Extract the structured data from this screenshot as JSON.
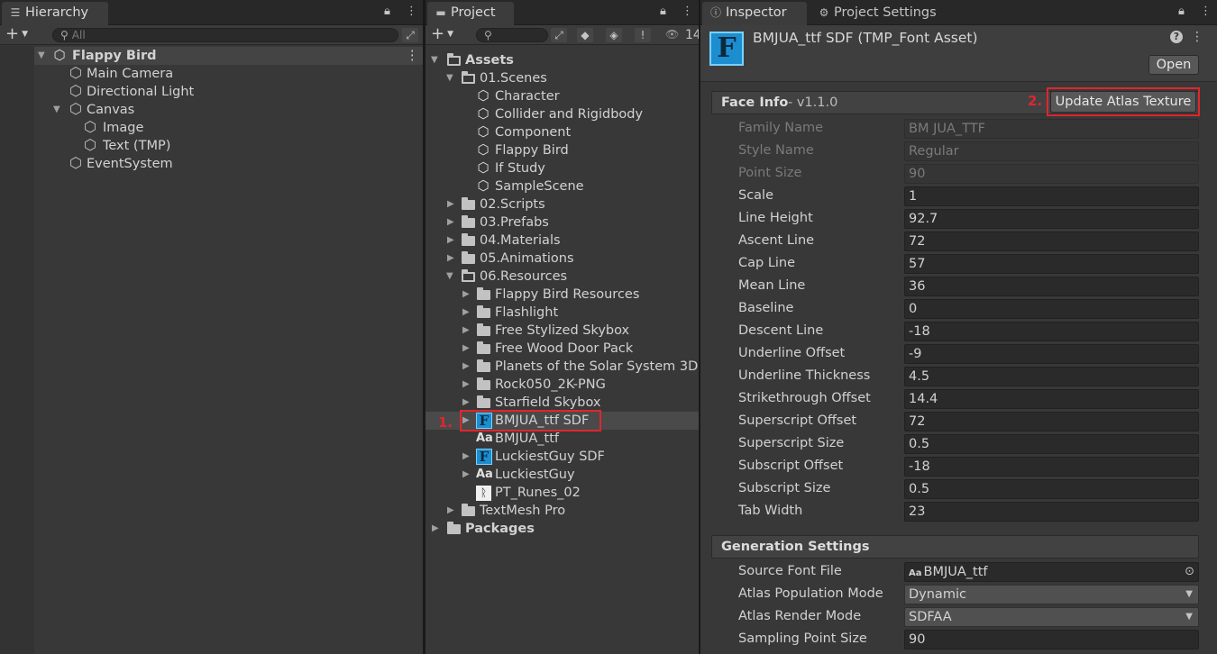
{
  "hierarchy": {
    "tab_label": "Hierarchy",
    "search_placeholder": "All",
    "scene_name": "Flappy Bird",
    "items": [
      {
        "label": "Main Camera"
      },
      {
        "label": "Directional Light"
      },
      {
        "label": "Canvas"
      },
      {
        "label": "Image"
      },
      {
        "label": "Text (TMP)"
      },
      {
        "label": "EventSystem"
      }
    ]
  },
  "project": {
    "tab_label": "Project",
    "search_placeholder": "",
    "visible_count": "14",
    "assets_label": "Assets",
    "scenes_folder": "01.Scenes",
    "scenes": [
      "Character",
      "Collider and Rigidbody",
      "Component",
      "Flappy Bird",
      "If Study",
      "SampleScene"
    ],
    "top_folders": [
      "02.Scripts",
      "03.Prefabs",
      "04.Materials",
      "05.Animations"
    ],
    "resources_folder": "06.Resources",
    "resource_folders": [
      "Flappy Bird Resources",
      "Flashlight",
      "Free Stylized Skybox",
      "Free Wood Door Pack",
      "Planets of the Solar System 3D",
      "Rock050_2K-PNG",
      "Starfield Skybox"
    ],
    "resource_assets": [
      {
        "label": "BMJUA_ttf SDF",
        "kind": "font-asset-icon"
      },
      {
        "label": "BMJUA_ttf",
        "kind": "font-file-icon"
      },
      {
        "label": "LuckiestGuy SDF",
        "kind": "font-asset-icon"
      },
      {
        "label": "LuckiestGuy",
        "kind": "font-file-icon"
      },
      {
        "label": "PT_Runes_02",
        "kind": "texture-icon"
      }
    ],
    "textmesh_folder": "TextMesh Pro",
    "packages_label": "Packages",
    "marker_1": "1."
  },
  "inspector": {
    "tab_label": "Inspector",
    "settings_tab_label": "Project Settings",
    "asset_title": "BMJUA_ttf SDF (TMP_Font Asset)",
    "open_label": "Open",
    "face_info_title": "Face Info",
    "face_info_version": "- v1.1.0",
    "update_atlas_label": "Update Atlas Texture",
    "marker_2": "2.",
    "face_props": [
      {
        "name": "Family Name",
        "value": "BM JUA_TTF",
        "disabled": true
      },
      {
        "name": "Style Name",
        "value": "Regular",
        "disabled": true
      },
      {
        "name": "Point Size",
        "value": "90",
        "disabled": true
      },
      {
        "name": "Scale",
        "value": "1"
      },
      {
        "name": "Line Height",
        "value": "92.7"
      },
      {
        "name": "Ascent Line",
        "value": "72"
      },
      {
        "name": "Cap Line",
        "value": "57"
      },
      {
        "name": "Mean Line",
        "value": "36"
      },
      {
        "name": "Baseline",
        "value": "0"
      },
      {
        "name": "Descent Line",
        "value": "-18"
      },
      {
        "name": "Underline Offset",
        "value": "-9"
      },
      {
        "name": "Underline Thickness",
        "value": "4.5"
      },
      {
        "name": "Strikethrough Offset",
        "value": "14.4"
      },
      {
        "name": "Superscript Offset",
        "value": "72"
      },
      {
        "name": "Superscript Size",
        "value": "0.5"
      },
      {
        "name": "Subscript Offset",
        "value": "-18"
      },
      {
        "name": "Subscript Size",
        "value": "0.5"
      },
      {
        "name": "Tab Width",
        "value": "23"
      }
    ],
    "generation_title": "Generation Settings",
    "gen_props": [
      {
        "name": "Source Font File",
        "value": "BMJUA_ttf"
      },
      {
        "name": "Atlas Population Mode",
        "value": "Dynamic"
      },
      {
        "name": "Atlas Render Mode",
        "value": "SDFAA"
      },
      {
        "name": "Sampling Point Size",
        "value": "90"
      }
    ]
  },
  "colors": {
    "highlight_red": "#e0262d",
    "font_asset_blue": "#1c8ecf"
  }
}
